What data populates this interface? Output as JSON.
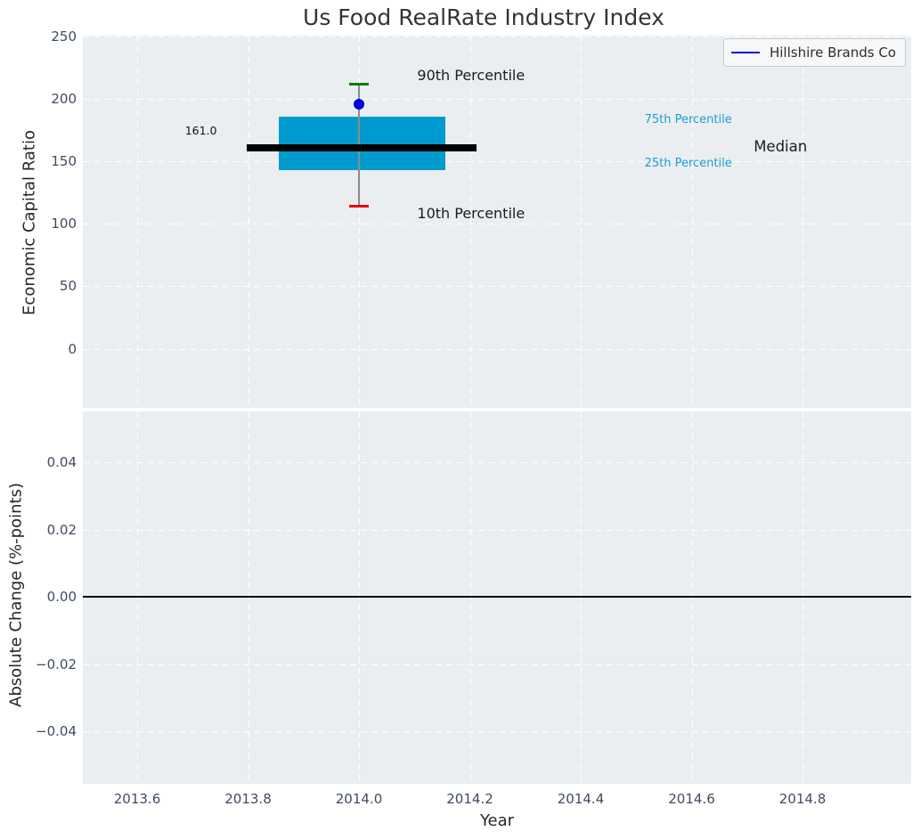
{
  "chart_data": [
    {
      "type": "box",
      "title": "Us Food RealRate Industry Index",
      "xlabel": "",
      "ylabel": "Economic Capital Ratio",
      "xlim": [
        2013.502,
        2014.996
      ],
      "ylim": [
        -47.4,
        250.7
      ],
      "yticks": [
        250,
        200,
        150,
        100,
        50,
        0
      ],
      "ytick_labels": [
        "250",
        "200",
        "150",
        "100",
        "50",
        "0"
      ],
      "xticks": [
        2013.6,
        2013.8,
        2014.0,
        2014.2,
        2014.4,
        2014.6,
        2014.8
      ],
      "x_tick_labels_shown": false,
      "grid": "white dashed, horizontal and vertical",
      "legend": {
        "label": "Hillshire Brands Co",
        "line_color": "#0000dd",
        "position": "upper right"
      },
      "box": {
        "x_center": 2014.0,
        "box_x_range": [
          2013.856,
          2014.156
        ],
        "median_x_range": [
          2013.798,
          2014.212
        ],
        "cap_x_range": [
          2013.983,
          2014.017
        ],
        "p10": 114,
        "q1": 143,
        "median": 161,
        "q3": 186,
        "p90": 212,
        "median_label": "161.0",
        "company_point": {
          "name": "Hillshire Brands Co",
          "x": 2014.0,
          "y": 196
        }
      },
      "annotations": [
        {
          "text": "90th Percentile",
          "x": 2014.105,
          "y": 218.5,
          "color": "#1c1c1c",
          "size": 16,
          "anchor": "left"
        },
        {
          "text": "10th Percentile",
          "x": 2014.105,
          "y": 108,
          "color": "#1c1c1c",
          "size": 16,
          "anchor": "left"
        },
        {
          "text": "Median",
          "x": 2014.712,
          "y": 161.5,
          "color": "#1c1c1c",
          "size": 16.5,
          "anchor": "left"
        },
        {
          "text": "75th Percentile",
          "x": 2014.515,
          "y": 183,
          "color": "#1a9dd4",
          "size": 13,
          "anchor": "left"
        },
        {
          "text": "25th Percentile",
          "x": 2014.515,
          "y": 148,
          "color": "#1a9dd4",
          "size": 13,
          "anchor": "left"
        },
        {
          "text": "161.0",
          "x": 2013.715,
          "y": 174.5,
          "color": "#141414",
          "size": 12.5,
          "anchor": "center"
        }
      ],
      "colors": {
        "box_fill": "#009bce",
        "median_line": "#000000",
        "whisker": "#8c8c8c",
        "cap_upper": "#007d00",
        "cap_lower": "#ee0000",
        "company_marker": "#0000db",
        "plot_background": "#eaeef0"
      }
    },
    {
      "type": "line",
      "title": "",
      "xlabel": "Year",
      "ylabel": "Absolute Change (%-points)",
      "xlim": [
        2013.502,
        2014.996
      ],
      "ylim": [
        -0.0556,
        0.0551
      ],
      "yticks": [
        0.04,
        0.02,
        0,
        -0.02,
        -0.04
      ],
      "ytick_labels": [
        "0.04",
        "0.02",
        "0.00",
        "−0.02",
        "−0.04"
      ],
      "xticks": [
        2013.6,
        2013.8,
        2014.0,
        2014.2,
        2014.4,
        2014.6,
        2014.8
      ],
      "xtick_labels": [
        "2013.6",
        "2013.8",
        "2014.0",
        "2014.2",
        "2014.4",
        "2014.6",
        "2014.8"
      ],
      "grid": "white dashed, horizontal and vertical",
      "zero_line": {
        "y": 0,
        "color": "#000000"
      },
      "series": []
    }
  ]
}
